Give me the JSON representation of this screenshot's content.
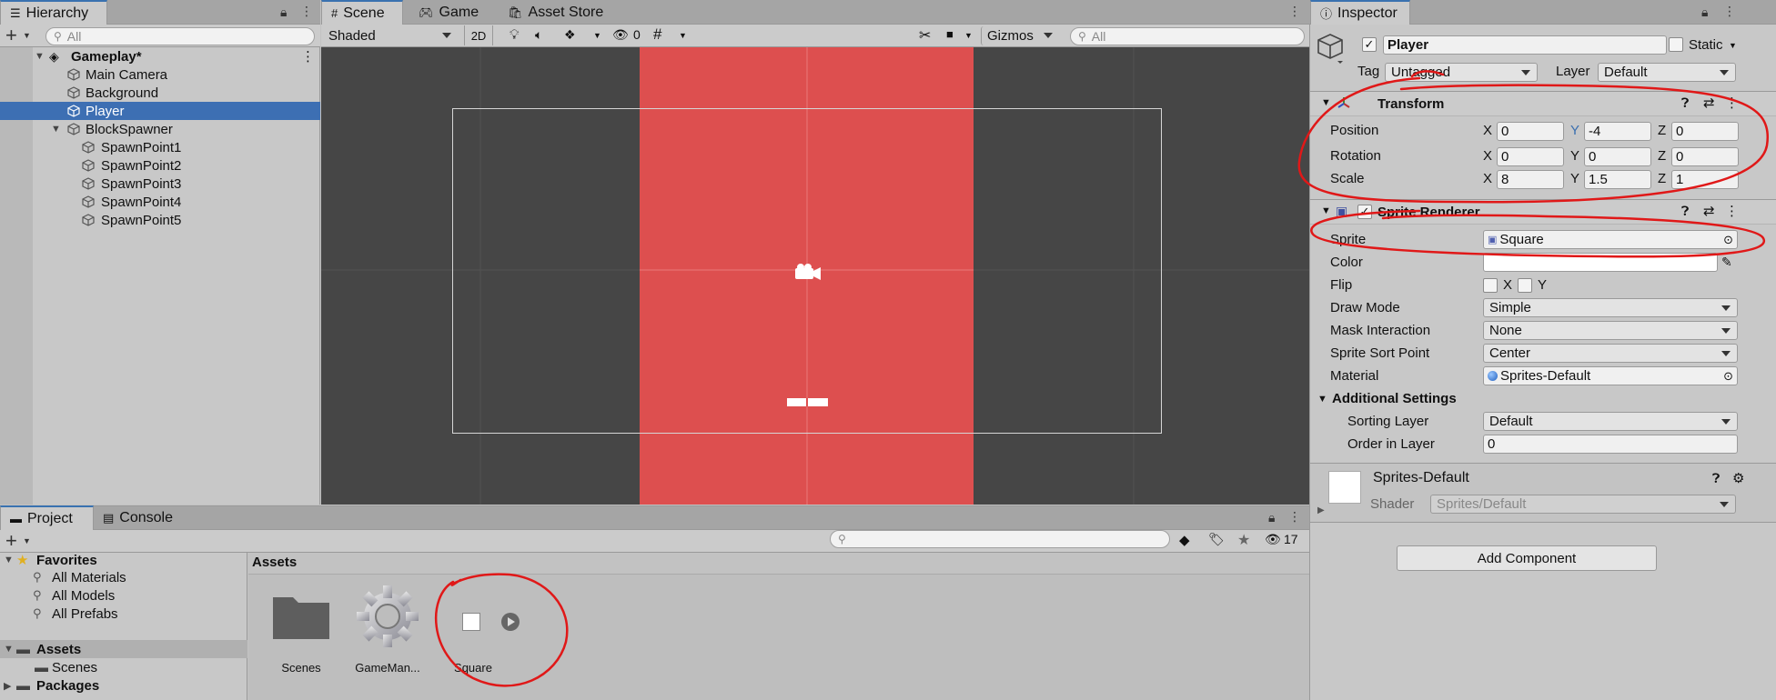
{
  "hierarchy": {
    "tab_label": "Hierarchy",
    "search_placeholder": "All",
    "scene_name": "Gameplay*",
    "items": [
      {
        "label": "Main Camera"
      },
      {
        "label": "Background"
      },
      {
        "label": "Player"
      },
      {
        "label": "BlockSpawner"
      },
      {
        "label": "SpawnPoint1"
      },
      {
        "label": "SpawnPoint2"
      },
      {
        "label": "SpawnPoint3"
      },
      {
        "label": "SpawnPoint4"
      },
      {
        "label": "SpawnPoint5"
      }
    ]
  },
  "scene_view": {
    "tabs": [
      "Scene",
      "Game",
      "Asset Store"
    ],
    "shading_mode": "Shaded",
    "mode_2d": "2D",
    "hidden_count": "0",
    "gizmos_label": "Gizmos",
    "search_placeholder": "All",
    "colors": {
      "background": "#464646",
      "red_sprite": "#dd4f4f",
      "camera_frame": "#d0d0d0"
    }
  },
  "project": {
    "tabs": [
      "Project",
      "Console"
    ],
    "hidden_count": "17",
    "favorites_label": "Favorites",
    "favorites": [
      "All Materials",
      "All Models",
      "All Prefabs"
    ],
    "assets_label": "Assets",
    "asset_folders": [
      "Scenes"
    ],
    "packages_label": "Packages",
    "breadcrumb": "Assets",
    "asset_items": [
      {
        "name": "Scenes",
        "icon": "folder-icon"
      },
      {
        "name": "GameMan...",
        "icon": "gear-icon"
      },
      {
        "name": "Square",
        "icon": "sprite-icon"
      }
    ]
  },
  "inspector": {
    "tab_label": "Inspector",
    "object_name": "Player",
    "static_label": "Static",
    "tag_label": "Tag",
    "tag_value": "Untagged",
    "layer_label": "Layer",
    "layer_value": "Default",
    "transform": {
      "title": "Transform",
      "position": {
        "label": "Position",
        "x": "0",
        "y": "-4",
        "z": "0"
      },
      "rotation": {
        "label": "Rotation",
        "x": "0",
        "y": "0",
        "z": "0"
      },
      "scale": {
        "label": "Scale",
        "x": "8",
        "y": "1.5",
        "z": "1"
      }
    },
    "sprite_renderer": {
      "title": "Sprite Renderer",
      "sprite_label": "Sprite",
      "sprite_value": "Square",
      "color_label": "Color",
      "flip_label": "Flip",
      "flip_x": "X",
      "flip_y": "Y",
      "draw_mode_label": "Draw Mode",
      "draw_mode_value": "Simple",
      "mask_label": "Mask Interaction",
      "mask_value": "None",
      "sort_point_label": "Sprite Sort Point",
      "sort_point_value": "Center",
      "material_label": "Material",
      "material_value": "Sprites-Default",
      "additional_label": "Additional Settings",
      "sorting_layer_label": "Sorting Layer",
      "sorting_layer_value": "Default",
      "order_label": "Order in Layer",
      "order_value": "0"
    },
    "material": {
      "name": "Sprites-Default",
      "shader_label": "Shader",
      "shader_value": "Sprites/Default"
    },
    "add_component": "Add Component"
  },
  "axis_labels": {
    "x": "X",
    "y": "Y",
    "z": "Z"
  },
  "annotation_color": "#e01818"
}
